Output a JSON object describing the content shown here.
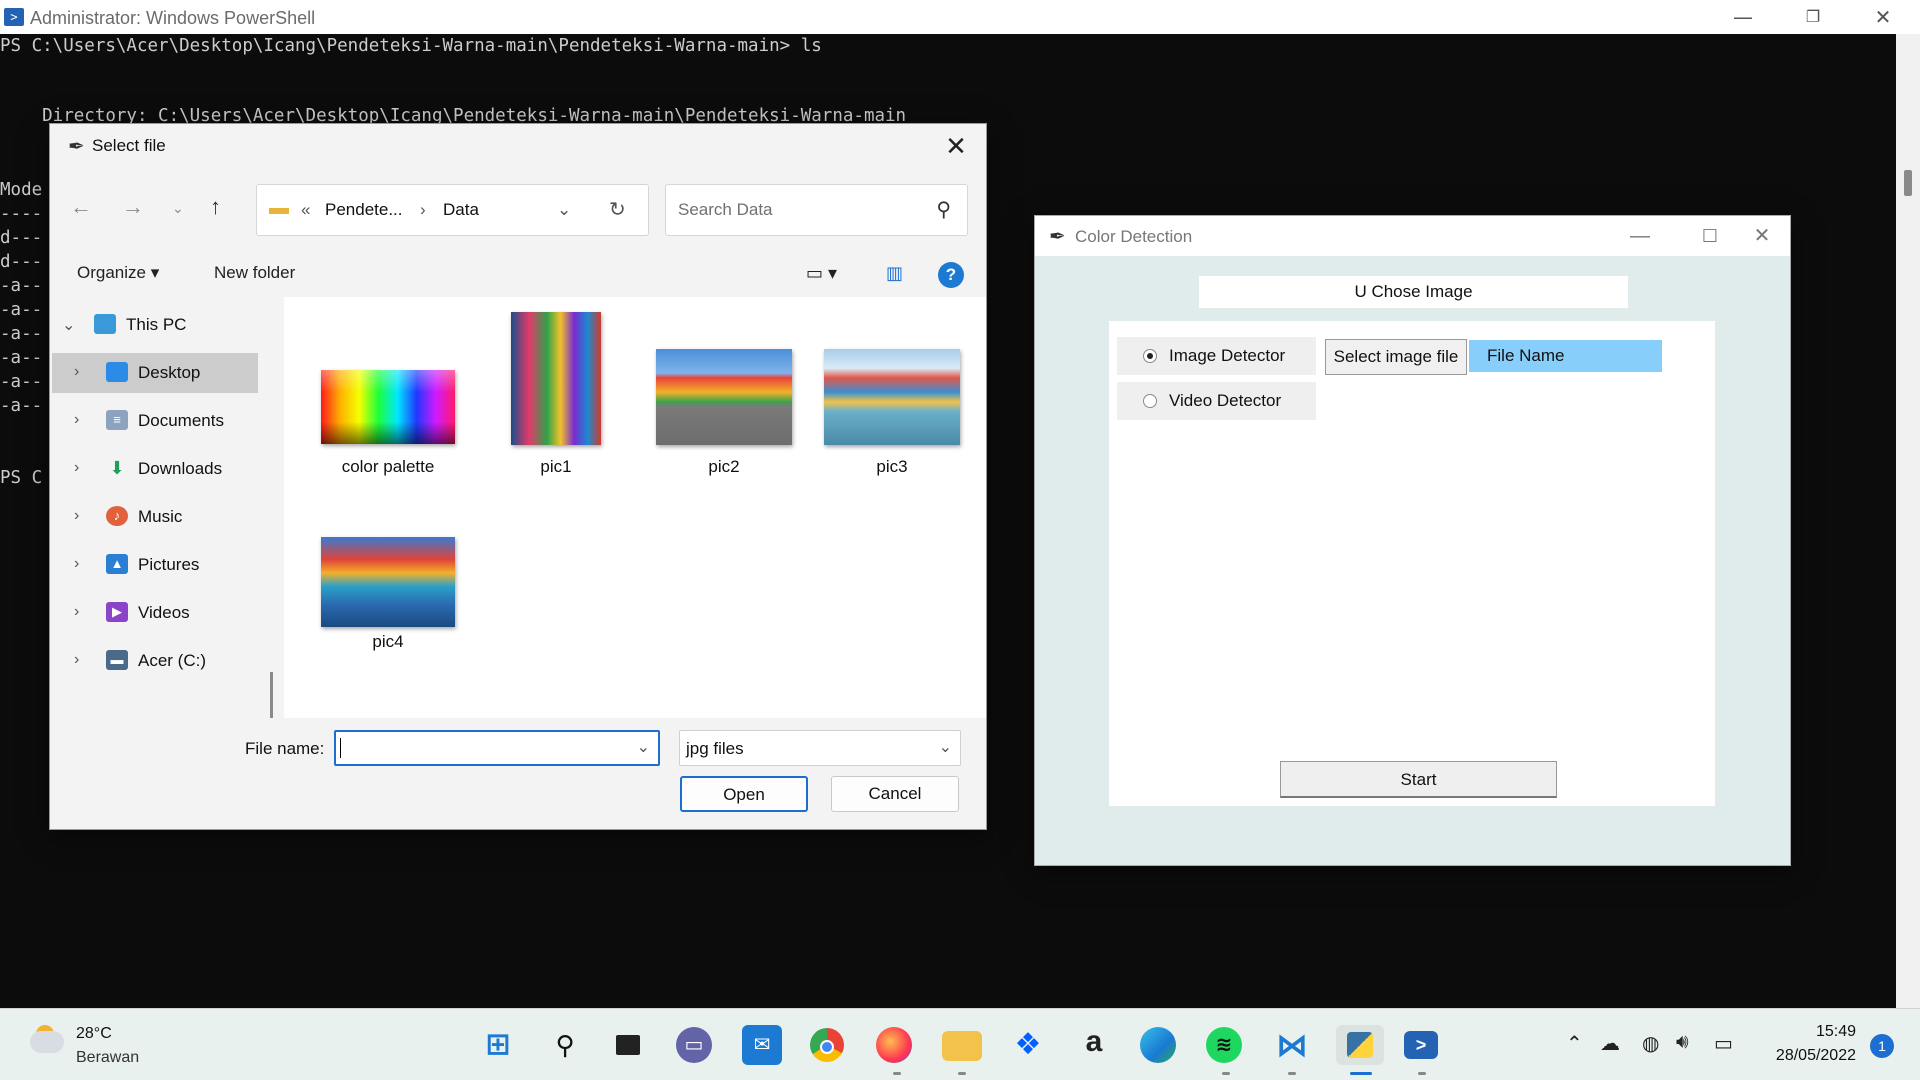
{
  "powershell": {
    "title": "Administrator: Windows PowerShell",
    "lines": {
      "l1": "PS C:\\Users\\Acer\\Desktop\\Icang\\Pendeteksi-Warna-main\\Pendeteksi-Warna-main> ls",
      "l2": "    Directory: C:\\Users\\Acer\\Desktop\\Icang\\Pendeteksi-Warna-main\\Pendeteksi-Warna-main",
      "l3": "Mode",
      "l4": "----",
      "l5": "d---",
      "l6": "d---",
      "l7": "-a--",
      "l8": "-a--",
      "l9": "-a--",
      "l10": "-a--",
      "l11": "-a--",
      "l12": "-a--",
      "l13": "PS C"
    }
  },
  "dialog": {
    "title": "Select file",
    "breadcrumb": {
      "sep": "«",
      "folder1": "Pendete...",
      "arrow": "›",
      "folder2": "Data"
    },
    "search_placeholder": "Search Data",
    "toolbar": {
      "organize": "Organize ▾",
      "new_folder": "New folder"
    },
    "nav": [
      {
        "label": "This PC"
      },
      {
        "label": "Desktop"
      },
      {
        "label": "Documents"
      },
      {
        "label": "Downloads"
      },
      {
        "label": "Music"
      },
      {
        "label": "Pictures"
      },
      {
        "label": "Videos"
      },
      {
        "label": "Acer (C:)"
      }
    ],
    "files": [
      {
        "name": "color palette"
      },
      {
        "name": "pic1"
      },
      {
        "name": "pic2"
      },
      {
        "name": "pic3"
      },
      {
        "name": "pic4"
      }
    ],
    "file_name_label": "File name:",
    "file_name_value": "",
    "file_type": "jpg files",
    "open_label": "Open",
    "cancel_label": "Cancel"
  },
  "color_detection": {
    "title": "Color Detection",
    "heading": "U Chose Image",
    "image_detector": "Image Detector",
    "video_detector": "Video Detector",
    "select_file": "Select image file",
    "file_name": "File Name",
    "start": "Start"
  },
  "taskbar": {
    "temperature": "28°C",
    "condition": "Berawan",
    "time": "15:49",
    "date": "28/05/2022",
    "notifications": "1",
    "apps": [
      "start",
      "search",
      "task-view",
      "teams-chat",
      "mail",
      "chrome",
      "firefox",
      "file-explorer",
      "dropbox",
      "amazon",
      "edge",
      "spotify",
      "vscode",
      "python",
      "powershell"
    ]
  }
}
